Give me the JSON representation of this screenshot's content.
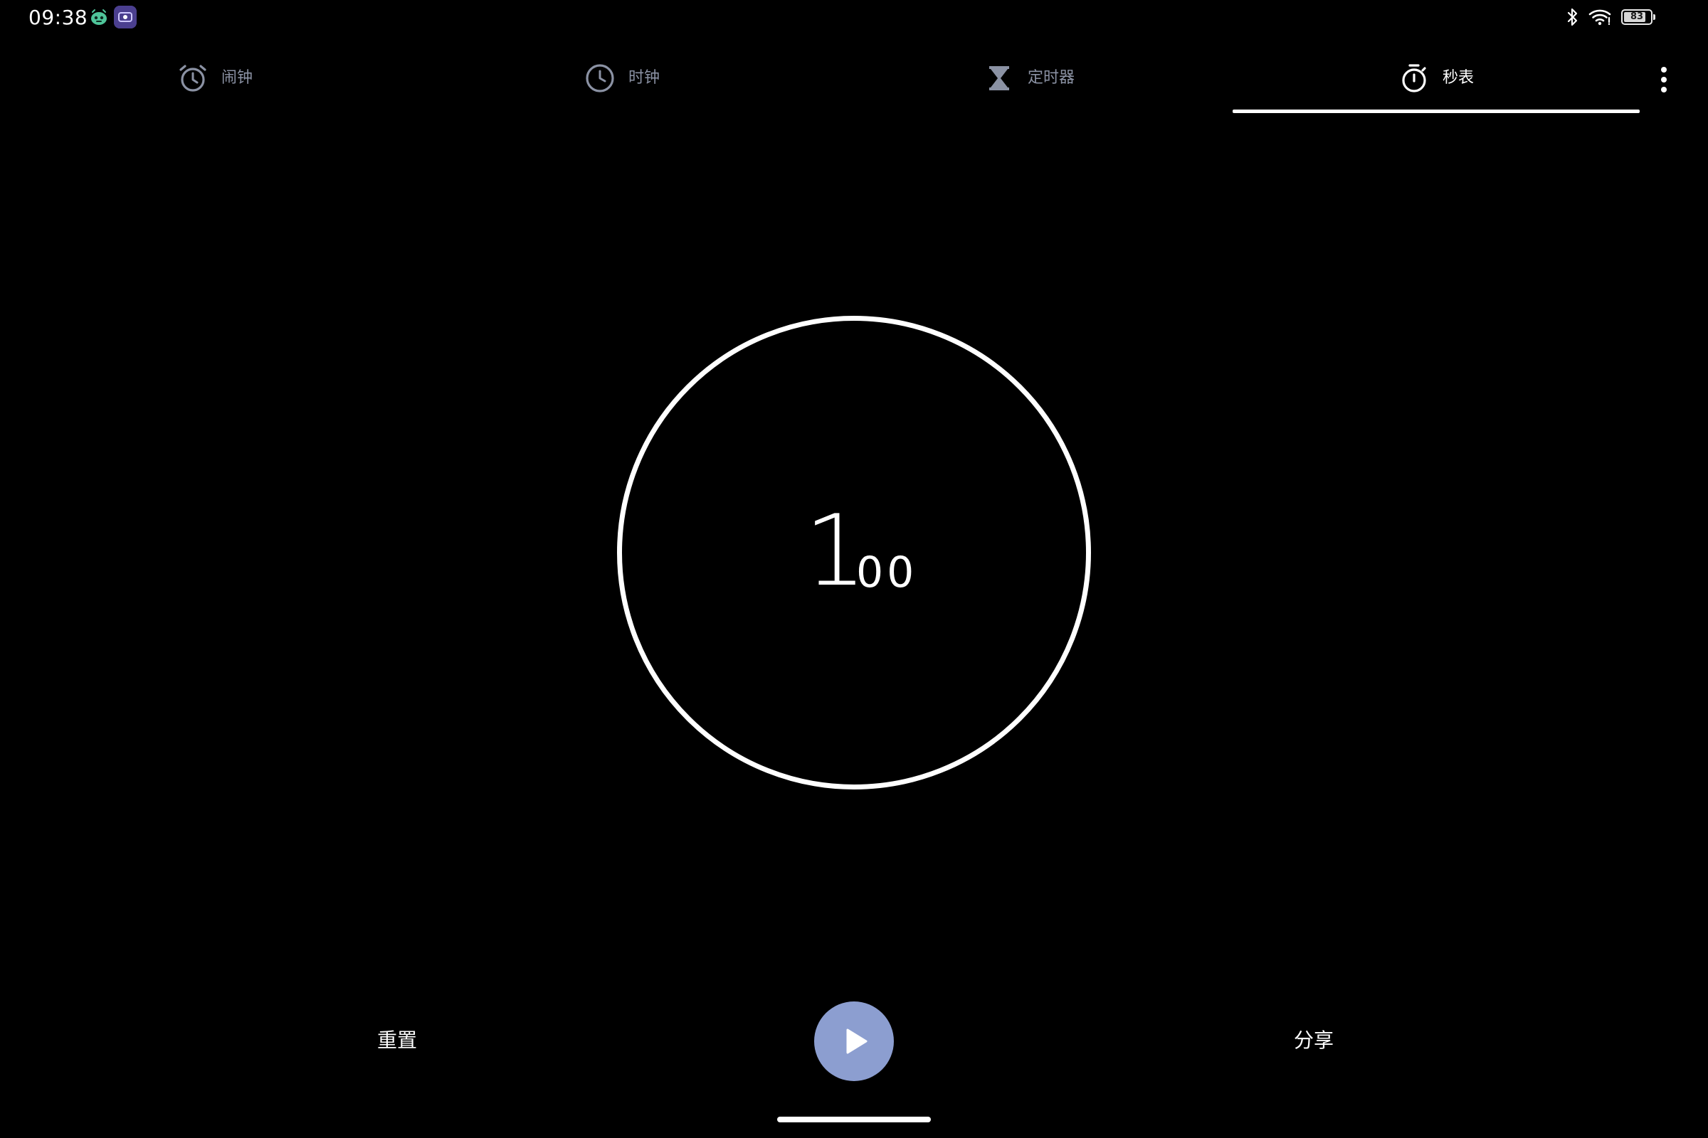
{
  "status_bar": {
    "time": "09:38",
    "battery_level": "83",
    "battery_fraction": 0.83,
    "icons": [
      "app-robot-icon",
      "screen-recorder-icon",
      "bluetooth-icon",
      "wifi-icon",
      "battery-icon"
    ]
  },
  "tabs": [
    {
      "label": "闹钟",
      "icon": "alarm-icon",
      "active": false
    },
    {
      "label": "时钟",
      "icon": "clock-icon",
      "active": false
    },
    {
      "label": "定时器",
      "icon": "hourglass-icon",
      "active": false
    },
    {
      "label": "秒表",
      "icon": "stopwatch-icon",
      "active": true
    }
  ],
  "stopwatch": {
    "seconds": "1",
    "hundredths": "00"
  },
  "controls": {
    "reset_label": "重置",
    "share_label": "分享",
    "play_icon": "play-icon"
  },
  "colors": {
    "background": "#000000",
    "accent": "#8c9ed0",
    "inactive_tab": "#8b92a4",
    "foreground": "#ffffff"
  }
}
